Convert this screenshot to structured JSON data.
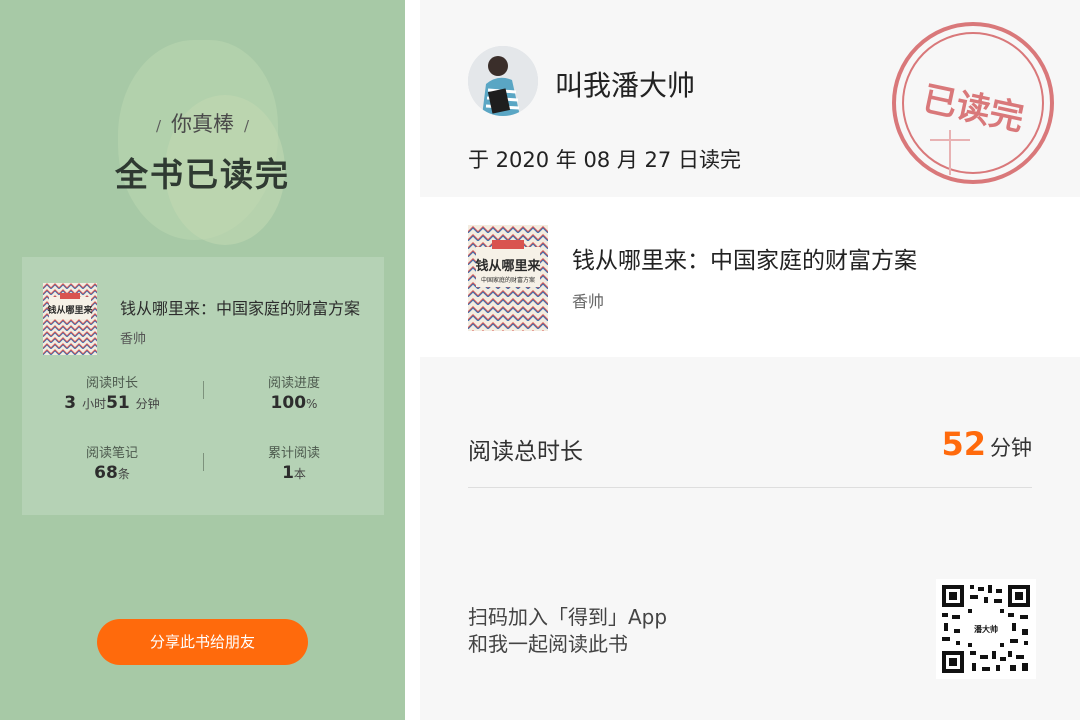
{
  "left_panel": {
    "praise": "你真棒",
    "praise_left_slash": "/",
    "praise_right_slash": "/",
    "title": "全书已读完",
    "book": {
      "title": "钱从哪里来：中国家庭的财富方案",
      "author": "香帅",
      "cover_text": "钱从哪里来"
    },
    "stats": {
      "reading_time": {
        "label": "阅读时长",
        "hours": "3",
        "hours_unit": "小时",
        "minutes": "51",
        "minutes_unit": "分钟"
      },
      "progress": {
        "label": "阅读进度",
        "value": "100",
        "unit": "%"
      },
      "notes": {
        "label": "阅读笔记",
        "value": "68",
        "unit": "条"
      },
      "total_books": {
        "label": "累计阅读",
        "value": "1",
        "unit": "本"
      }
    },
    "share_button": "分享此书给朋友"
  },
  "right_panel": {
    "username": "叫我潘大帅",
    "finish_date": "于 2020 年 08 月 27 日读完",
    "stamp_text": "已读完",
    "book": {
      "title": "钱从哪里来：中国家庭的财富方案",
      "author": "香帅",
      "cover_text": "钱从哪里来",
      "cover_subtext": "中国家庭的财富方案"
    },
    "total_time": {
      "label": "阅读总时长",
      "value": "52",
      "unit": "分钟"
    },
    "join_line1": "扫码加入「得到」App",
    "join_line2": "和我一起阅读此书",
    "qr_center_text": "潘大帅"
  },
  "colors": {
    "left_bg": "#a7c9a6",
    "accent_orange": "#ff6a0c",
    "stamp_red": "#d9787a",
    "right_bg": "#f7f7f7"
  }
}
